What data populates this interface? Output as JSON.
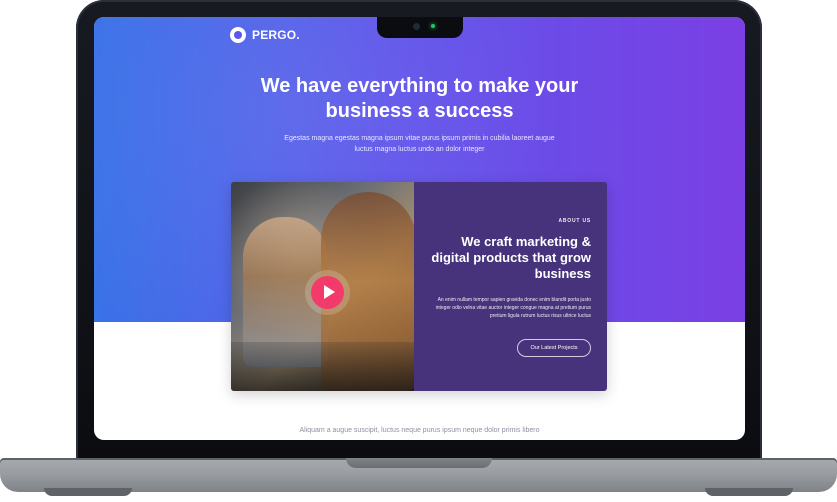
{
  "brand": {
    "name": "PERGO."
  },
  "hero": {
    "title": "We have everything to make your business a success",
    "subtitle": "Egestas magna egestas magna ipsum vitae purus ipsum primis in cubilia laoreet augue luctus magna luctus undo an dolor integer"
  },
  "feature": {
    "eyebrow": "ABOUT US",
    "heading": "We craft marketing & digital products that grow business",
    "body": "An enim nullam tempor sapien gravida donec enim blandit porta justo integer odio velna vitae auctor integer congue magna at pretium purus pretium ligula rutrum luctus risus ultrice luctus",
    "cta_label": "Our Latest Projects"
  },
  "below": {
    "text": "Aliquam a augue suscipit, luctus neque purus ipsum neque dolor primis libero"
  },
  "icons": {
    "play": "play-icon",
    "logo": "pergo-logo-icon",
    "camera": "camera-icon"
  },
  "colors": {
    "hero_left": "#3a72e8",
    "hero_right": "#7b3fe4",
    "panel": "#47337c",
    "play": "#f23b6b"
  }
}
